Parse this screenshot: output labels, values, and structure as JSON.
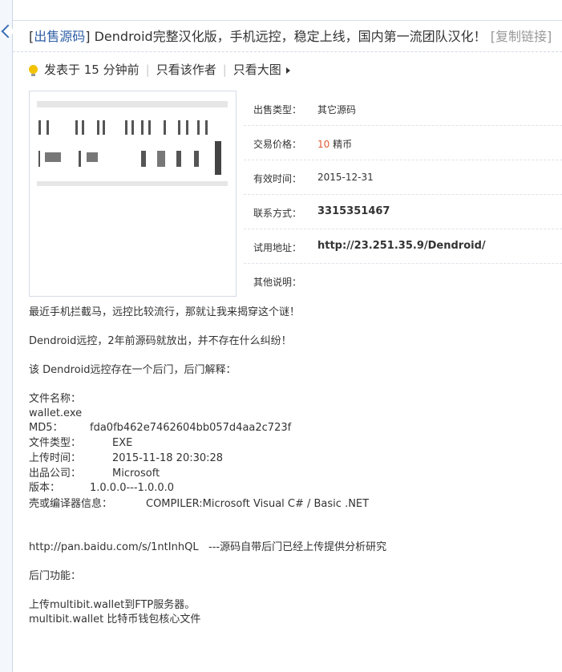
{
  "title": {
    "tag": "出售源码",
    "text": " Dendroid完整汉化版，手机远控，稳定上线，国内第一流团队汉化！",
    "copy_link": "[复制链接]"
  },
  "meta": {
    "posted": "发表于 15 分钟前",
    "only_author": "只看该作者",
    "big_image": "只看大图"
  },
  "info_rows": [
    {
      "label": "出售类型：",
      "value": "其它源码"
    },
    {
      "label": "交易价格：",
      "value_num": "10",
      "value_unit": " 精币"
    },
    {
      "label": "有效时间：",
      "value": "2015-12-31"
    },
    {
      "label": "联系方式：",
      "value": "3315351467"
    },
    {
      "label": "试用地址：",
      "value": "http://23.251.35.9/Dendroid/"
    },
    {
      "label": "其他说明：",
      "value": ""
    }
  ],
  "body": {
    "p1": "最近手机拦截马，远控比较流行，那就让我来揭穿这个谜！",
    "p2": "Dendroid远控，2年前源码就放出，并不存在什么纠纷！",
    "p3": "该 Dendroid远控存在一个后门，后门解释：",
    "file_name_label": "文件名称：",
    "file_name": "wallet.exe",
    "md5_label": "MD5：",
    "md5": "fda0fb462e7462604bb057d4aa2c723f",
    "type_label": "文件类型：",
    "type": "EXE",
    "upload_label": "上传时间：",
    "upload": "2015-11-18 20:30:28",
    "company_label": "出品公司：",
    "company": "Microsoft",
    "version_label": "版本：",
    "version": "1.0.0.0---1.0.0.0",
    "compiler_label": "壳或编译器信息：",
    "compiler": "COMPILER:Microsoft Visual C# / Basic .NET",
    "link": "http://pan.baidu.com/s/1ntInhQL",
    "link_note": "---源码自带后门已经上传提供分析研究",
    "backdoor_label": "后门功能：",
    "feature1": "上传multibit.wallet到FTP服务器。",
    "feature2": "multibit.wallet 比特币钱包核心文件"
  }
}
